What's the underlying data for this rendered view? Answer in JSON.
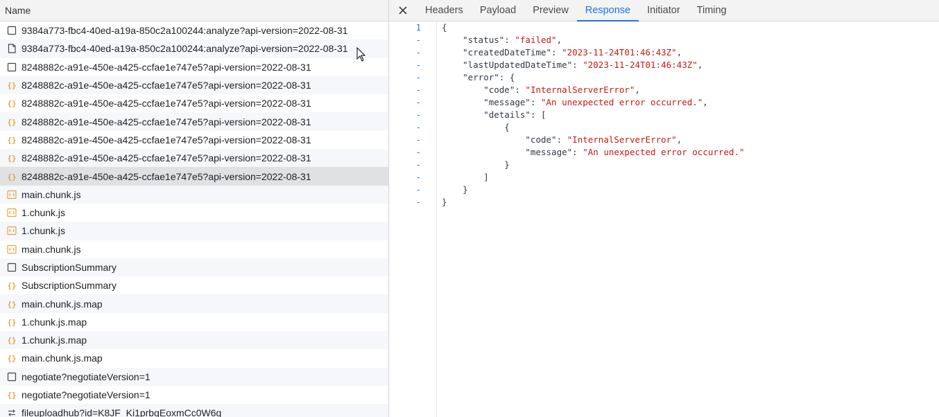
{
  "list": {
    "header": "Name",
    "rows": [
      {
        "name": "9384a773-fbc4-40ed-a19a-850c2a100244:analyze?api-version=2022-08-31",
        "icon": "checkbox-doc-icon",
        "state": "normal"
      },
      {
        "name": "9384a773-fbc4-40ed-a19a-850c2a100244:analyze?api-version=2022-08-31",
        "icon": "document-icon",
        "state": "alt"
      },
      {
        "name": "8248882c-a91e-450e-a425-ccfae1e747e5?api-version=2022-08-31",
        "icon": "checkbox-doc-icon",
        "state": "normal"
      },
      {
        "name": "8248882c-a91e-450e-a425-ccfae1e747e5?api-version=2022-08-31",
        "icon": "fetch-icon",
        "state": "alt"
      },
      {
        "name": "8248882c-a91e-450e-a425-ccfae1e747e5?api-version=2022-08-31",
        "icon": "fetch-icon",
        "state": "normal"
      },
      {
        "name": "8248882c-a91e-450e-a425-ccfae1e747e5?api-version=2022-08-31",
        "icon": "fetch-icon",
        "state": "alt"
      },
      {
        "name": "8248882c-a91e-450e-a425-ccfae1e747e5?api-version=2022-08-31",
        "icon": "fetch-icon",
        "state": "normal"
      },
      {
        "name": "8248882c-a91e-450e-a425-ccfae1e747e5?api-version=2022-08-31",
        "icon": "fetch-icon",
        "state": "alt"
      },
      {
        "name": "8248882c-a91e-450e-a425-ccfae1e747e5?api-version=2022-08-31",
        "icon": "fetch-icon",
        "state": "selected"
      },
      {
        "name": "main.chunk.js",
        "icon": "script-icon",
        "state": "alt"
      },
      {
        "name": "1.chunk.js",
        "icon": "script-icon",
        "state": "normal"
      },
      {
        "name": "1.chunk.js",
        "icon": "script-icon",
        "state": "alt"
      },
      {
        "name": "main.chunk.js",
        "icon": "script-icon",
        "state": "normal"
      },
      {
        "name": "SubscriptionSummary",
        "icon": "checkbox-doc-icon",
        "state": "alt"
      },
      {
        "name": "SubscriptionSummary",
        "icon": "fetch-icon",
        "state": "normal"
      },
      {
        "name": "main.chunk.js.map",
        "icon": "fetch-icon",
        "state": "alt"
      },
      {
        "name": "1.chunk.js.map",
        "icon": "fetch-icon",
        "state": "normal"
      },
      {
        "name": "1.chunk.js.map",
        "icon": "fetch-icon",
        "state": "alt"
      },
      {
        "name": "main.chunk.js.map",
        "icon": "fetch-icon",
        "state": "normal"
      },
      {
        "name": "negotiate?negotiateVersion=1",
        "icon": "checkbox-doc-icon",
        "state": "alt"
      },
      {
        "name": "negotiate?negotiateVersion=1",
        "icon": "fetch-icon",
        "state": "normal"
      },
      {
        "name": "fileuploadhub?id=K8JF_Ki1prbgEoxmCc0W6g",
        "icon": "websocket-icon",
        "state": "alt"
      }
    ]
  },
  "tabs": {
    "close_icon": "close-icon",
    "items": [
      "Headers",
      "Payload",
      "Preview",
      "Response",
      "Initiator",
      "Timing"
    ],
    "active": "Response"
  },
  "response": {
    "gutter": [
      "1",
      "-",
      "-",
      "-",
      "-",
      "-",
      "-",
      "-",
      "-",
      "-",
      "-",
      "-",
      "-",
      "-",
      "-"
    ],
    "lines": [
      [
        {
          "t": "{",
          "c": "p"
        }
      ],
      [
        {
          "t": "    \"status\"",
          "c": "k"
        },
        {
          "t": ": ",
          "c": "p"
        },
        {
          "t": "\"failed\"",
          "c": "s"
        },
        {
          "t": ",",
          "c": "p"
        }
      ],
      [
        {
          "t": "    \"createdDateTime\"",
          "c": "k"
        },
        {
          "t": ": ",
          "c": "p"
        },
        {
          "t": "\"2023-11-24T01:46:43Z\"",
          "c": "s"
        },
        {
          "t": ",",
          "c": "p"
        }
      ],
      [
        {
          "t": "    \"lastUpdatedDateTime\"",
          "c": "k"
        },
        {
          "t": ": ",
          "c": "p"
        },
        {
          "t": "\"2023-11-24T01:46:43Z\"",
          "c": "s"
        },
        {
          "t": ",",
          "c": "p"
        }
      ],
      [
        {
          "t": "    \"error\"",
          "c": "k"
        },
        {
          "t": ": {",
          "c": "p"
        }
      ],
      [
        {
          "t": "        \"code\"",
          "c": "k"
        },
        {
          "t": ": ",
          "c": "p"
        },
        {
          "t": "\"InternalServerError\"",
          "c": "s"
        },
        {
          "t": ",",
          "c": "p"
        }
      ],
      [
        {
          "t": "        \"message\"",
          "c": "k"
        },
        {
          "t": ": ",
          "c": "p"
        },
        {
          "t": "\"An unexpected error occurred.\"",
          "c": "s"
        },
        {
          "t": ",",
          "c": "p"
        }
      ],
      [
        {
          "t": "        \"details\"",
          "c": "k"
        },
        {
          "t": ": [",
          "c": "p"
        }
      ],
      [
        {
          "t": "            {",
          "c": "p"
        }
      ],
      [
        {
          "t": "                \"code\"",
          "c": "k"
        },
        {
          "t": ": ",
          "c": "p"
        },
        {
          "t": "\"InternalServerError\"",
          "c": "s"
        },
        {
          "t": ",",
          "c": "p"
        }
      ],
      [
        {
          "t": "                \"message\"",
          "c": "k"
        },
        {
          "t": ": ",
          "c": "p"
        },
        {
          "t": "\"An unexpected error occurred.\"",
          "c": "s"
        }
      ],
      [
        {
          "t": "            }",
          "c": "p"
        }
      ],
      [
        {
          "t": "        ]",
          "c": "p"
        }
      ],
      [
        {
          "t": "    }",
          "c": "p"
        }
      ],
      [
        {
          "t": "}",
          "c": "p"
        }
      ]
    ]
  },
  "colors": {
    "accent": "#1a73e8",
    "string": "#c41a16",
    "fetch_icon": "#e8a33d",
    "script_icon": "#e8a33d"
  }
}
